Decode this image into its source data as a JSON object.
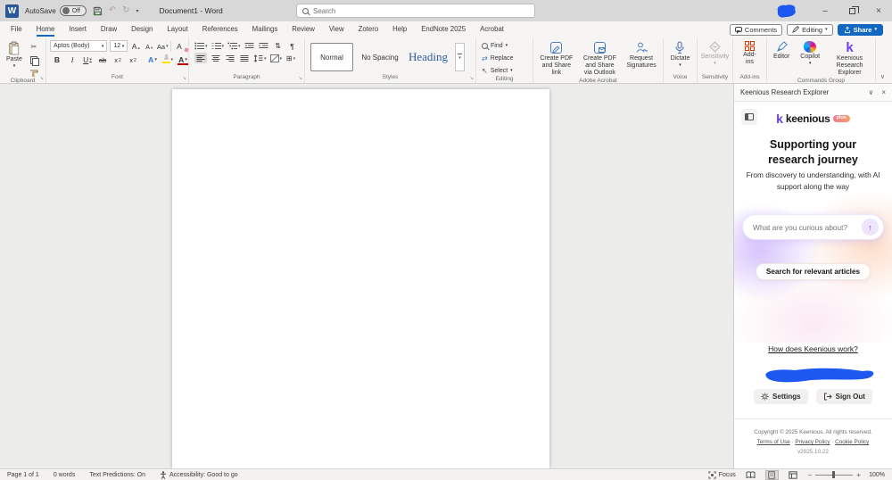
{
  "colors": {
    "accent": "#1267c1",
    "keenious_purple": "#6b3df2",
    "scribble": "#1d58f0"
  },
  "glyphs": {
    "caret": "▾",
    "chevron": "∨",
    "close": "×",
    "minimize": "–",
    "undo": "↶",
    "redo": "↻",
    "scissors": "✂",
    "pilcrow": "¶",
    "sort": "⇅",
    "borders": "⊞",
    "arrow_up": "↑",
    "dot_sep": "·",
    "logo_letter": "W",
    "k": "k"
  },
  "titlebar": {
    "autosave": "AutoSave",
    "autosave_state": "Off",
    "title": "Document1 - Word",
    "search_placeholder": "Search"
  },
  "tabs": {
    "items": [
      "File",
      "Home",
      "Insert",
      "Draw",
      "Design",
      "Layout",
      "References",
      "Mailings",
      "Review",
      "View",
      "Zotero",
      "Help",
      "EndNote 2025",
      "Acrobat"
    ]
  },
  "tabactions": {
    "comments": "Comments",
    "editing": "Editing",
    "share": "Share"
  },
  "ribbon": {
    "clipboard": {
      "paste": "Paste",
      "label": "Clipboard"
    },
    "font": {
      "name": "Aptos (Body)",
      "size": "12",
      "label": "Font",
      "bold": "B",
      "italic": "I",
      "underline": "U",
      "strike": "ab",
      "sub_base": "x",
      "sub_mark": "2",
      "sup_base": "x",
      "sup_mark": "2",
      "grow": "A",
      "shrink": "A",
      "case": "Aa",
      "clear": "A",
      "effects": "A",
      "color": "A"
    },
    "paragraph": {
      "label": "Paragraph"
    },
    "styles": {
      "s1": "Normal",
      "s2": "No Spacing",
      "s3": "Heading",
      "label": "Styles"
    },
    "editing": {
      "find": "Find",
      "replace": "Replace",
      "select": "Select",
      "label": "Editing"
    },
    "acrobat": {
      "b1": "Create PDF and Share link",
      "b2": "Create PDF and Share via Outlook",
      "b3": "Request Signatures",
      "label": "Adobe Acrobat"
    },
    "voice": {
      "dictate": "Dictate",
      "label": "Voice"
    },
    "sensitivity": {
      "btn": "Sensitivity",
      "label": "Sensitivity"
    },
    "addins": {
      "btn": "Add-ins",
      "label": "Add-ins"
    },
    "commands": {
      "editor": "Editor",
      "copilot": "Copilot",
      "keenious": "Keenious Research Explorer",
      "label": "Commands Group"
    }
  },
  "panel": {
    "title": "Keenious Research Explorer",
    "logo": "keenious",
    "badge": "plus",
    "heading": "Supporting your research journey",
    "subtitle": "From discovery to understanding, with AI support along the way",
    "input_placeholder": "What are you curious about?",
    "search_button": "Search for relevant articles",
    "how_link": "How does Keenious work?",
    "settings": "Settings",
    "signout": "Sign Out",
    "copyright": "Copyright © 2025 Keenious. All rights reserved.",
    "links": [
      "Terms of Use",
      "Privacy Policy",
      "Cookie Policy"
    ],
    "version": "v2025.10.22"
  },
  "statusbar": {
    "page": "Page 1 of 1",
    "words": "0 words",
    "predictions": "Text Predictions: On",
    "accessibility": "Accessibility: Good to go",
    "focus": "Focus",
    "zoom": "100%"
  }
}
